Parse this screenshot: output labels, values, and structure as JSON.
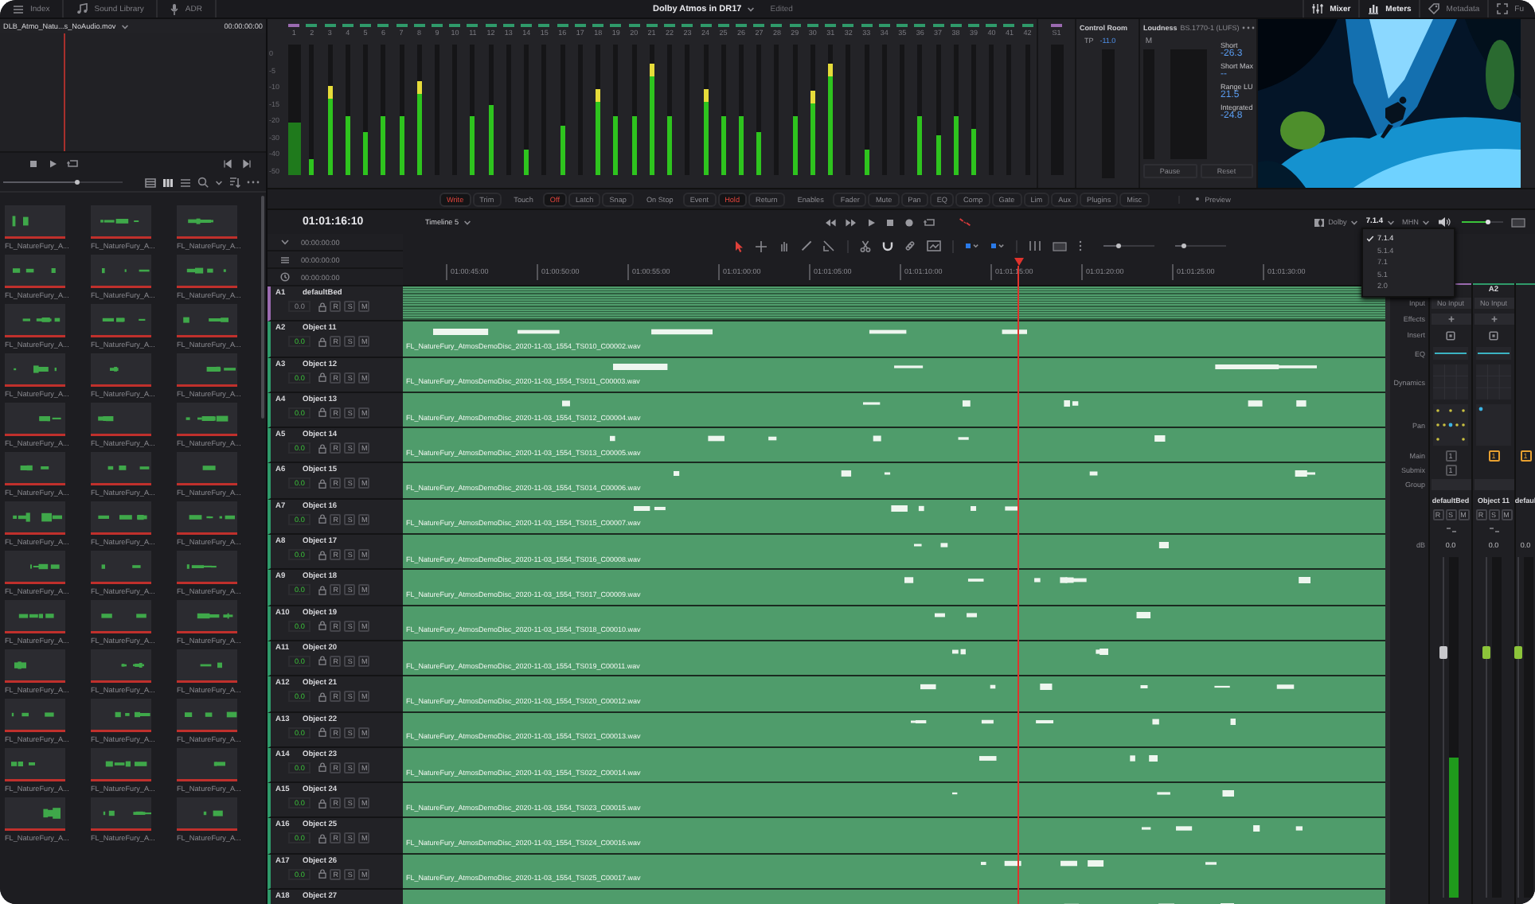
{
  "topbar": {
    "left_tabs": [
      {
        "label": "Index"
      },
      {
        "label": "Sound Library"
      },
      {
        "label": "ADR"
      }
    ],
    "project_title": "Dolby Atmos in DR17",
    "project_status": "Edited",
    "right_tabs": [
      {
        "label": "Mixer",
        "on": true
      },
      {
        "label": "Meters",
        "on": true
      },
      {
        "label": "Metadata",
        "on": false
      },
      {
        "label": "Fu",
        "on": false
      }
    ]
  },
  "viewer": {
    "clip_name": "DLB_Atmo_Natu...s_NoAudio.mov",
    "timecode": "00:00:00:00",
    "playhead": {
      "level": 0.24
    }
  },
  "media_pool": {
    "zoom": {
      "level": 0.6
    },
    "clips": [
      {
        "name": "FL_NatureFury_A..."
      },
      {
        "name": "FL_NatureFury_A..."
      },
      {
        "name": "FL_NatureFury_A..."
      },
      {
        "name": "FL_NatureFury_A..."
      },
      {
        "name": "FL_NatureFury_A..."
      },
      {
        "name": "FL_NatureFury_A..."
      },
      {
        "name": "FL_NatureFury_A..."
      },
      {
        "name": "FL_NatureFury_A..."
      },
      {
        "name": "FL_NatureFury_A..."
      },
      {
        "name": "FL_NatureFury_A..."
      },
      {
        "name": "FL_NatureFury_A..."
      },
      {
        "name": "FL_NatureFury_A..."
      },
      {
        "name": "FL_NatureFury_A..."
      },
      {
        "name": "FL_NatureFury_A..."
      },
      {
        "name": "FL_NatureFury_A..."
      },
      {
        "name": "FL_NatureFury_A..."
      },
      {
        "name": "FL_NatureFury_A..."
      },
      {
        "name": "FL_NatureFury_A..."
      },
      {
        "name": "FL_NatureFury_A..."
      },
      {
        "name": "FL_NatureFury_A..."
      },
      {
        "name": "FL_NatureFury_A..."
      },
      {
        "name": "FL_NatureFury_A..."
      },
      {
        "name": "FL_NatureFury_A..."
      },
      {
        "name": "FL_NatureFury_A..."
      },
      {
        "name": "FL_NatureFury_A..."
      },
      {
        "name": "FL_NatureFury_A..."
      },
      {
        "name": "FL_NatureFury_A..."
      },
      {
        "name": "FL_NatureFury_A..."
      },
      {
        "name": "FL_NatureFury_A..."
      },
      {
        "name": "FL_NatureFury_A..."
      },
      {
        "name": "FL_NatureFury_A..."
      },
      {
        "name": "FL_NatureFury_A..."
      },
      {
        "name": "FL_NatureFury_A..."
      },
      {
        "name": "FL_NatureFury_A..."
      },
      {
        "name": "FL_NatureFury_A..."
      },
      {
        "name": "FL_NatureFury_A..."
      },
      {
        "name": "FL_NatureFury_A..."
      },
      {
        "name": "FL_NatureFury_A..."
      },
      {
        "name": "FL_NatureFury_A..."
      }
    ]
  },
  "meter_bridge": {
    "scale": [
      "0",
      "-5",
      "-10",
      "-15",
      "-20",
      "-30",
      "-40",
      "-50"
    ],
    "channels": [
      {
        "label": "1",
        "kind": "bed",
        "level": 0.4,
        "over": false
      },
      {
        "label": "2",
        "kind": "object",
        "level": 0.12,
        "over": false
      },
      {
        "label": "3",
        "kind": "object",
        "level": 0.58,
        "over": true
      },
      {
        "label": "4",
        "kind": "object",
        "level": 0.45,
        "over": false
      },
      {
        "label": "5",
        "kind": "object",
        "level": 0.33,
        "over": false
      },
      {
        "label": "6",
        "kind": "object",
        "level": 0.45,
        "over": false
      },
      {
        "label": "7",
        "kind": "object",
        "level": 0.45,
        "over": false
      },
      {
        "label": "8",
        "kind": "object",
        "level": 0.62,
        "over": true
      },
      {
        "label": "9",
        "kind": "object",
        "level": 0,
        "over": false
      },
      {
        "label": "10",
        "kind": "object",
        "level": 0,
        "over": false
      },
      {
        "label": "11",
        "kind": "object",
        "level": 0.45,
        "over": false
      },
      {
        "label": "12",
        "kind": "object",
        "level": 0.53,
        "over": false
      },
      {
        "label": "13",
        "kind": "object",
        "level": 0,
        "over": false
      },
      {
        "label": "14",
        "kind": "object",
        "level": 0.2,
        "over": false
      },
      {
        "label": "15",
        "kind": "object",
        "level": 0,
        "over": false
      },
      {
        "label": "16",
        "kind": "object",
        "level": 0.37,
        "over": false
      },
      {
        "label": "17",
        "kind": "object",
        "level": 0,
        "over": false
      },
      {
        "label": "18",
        "kind": "object",
        "level": 0.56,
        "over": true
      },
      {
        "label": "19",
        "kind": "object",
        "level": 0.45,
        "over": false
      },
      {
        "label": "20",
        "kind": "object",
        "level": 0.45,
        "over": false
      },
      {
        "label": "21",
        "kind": "object",
        "level": 0.75,
        "over": true
      },
      {
        "label": "22",
        "kind": "object",
        "level": 0.45,
        "over": false
      },
      {
        "label": "23",
        "kind": "object",
        "level": 0,
        "over": false
      },
      {
        "label": "24",
        "kind": "object",
        "level": 0.56,
        "over": true
      },
      {
        "label": "25",
        "kind": "object",
        "level": 0.45,
        "over": false
      },
      {
        "label": "26",
        "kind": "object",
        "level": 0.45,
        "over": false
      },
      {
        "label": "27",
        "kind": "object",
        "level": 0.33,
        "over": false
      },
      {
        "label": "28",
        "kind": "object",
        "level": 0,
        "over": false
      },
      {
        "label": "29",
        "kind": "object",
        "level": 0.45,
        "over": false
      },
      {
        "label": "30",
        "kind": "object",
        "level": 0.55,
        "over": true
      },
      {
        "label": "31",
        "kind": "object",
        "level": 0.75,
        "over": true
      },
      {
        "label": "32",
        "kind": "object",
        "level": 0,
        "over": false
      },
      {
        "label": "33",
        "kind": "object",
        "level": 0.2,
        "over": false
      },
      {
        "label": "34",
        "kind": "object",
        "level": 0,
        "over": false
      },
      {
        "label": "35",
        "kind": "object",
        "level": 0,
        "over": false
      },
      {
        "label": "36",
        "kind": "object",
        "level": 0.45,
        "over": false
      },
      {
        "label": "37",
        "kind": "object",
        "level": 0.3,
        "over": false
      },
      {
        "label": "38",
        "kind": "object",
        "level": 0.45,
        "over": false
      },
      {
        "label": "39",
        "kind": "object",
        "level": 0.35,
        "over": false
      },
      {
        "label": "40",
        "kind": "object",
        "level": 0,
        "over": false
      },
      {
        "label": "41",
        "kind": "object",
        "level": 0,
        "over": false
      },
      {
        "label": "42",
        "kind": "object",
        "level": 0,
        "over": false
      }
    ],
    "monitor": {
      "label": "S1"
    }
  },
  "control_room": {
    "title": "Control Room",
    "tp_label": "TP",
    "tp_value": "-11.0"
  },
  "loudness": {
    "title": "Loudness",
    "standard": "BS.1770-1 (LUFS)",
    "meter_label": "M",
    "readings": [
      {
        "label": "Short",
        "value": "-26.3"
      },
      {
        "label": "Short Max",
        "value": "--"
      },
      {
        "label": "Range LU",
        "value": "21.5"
      },
      {
        "label": "Integrated",
        "value": "-24.8"
      }
    ],
    "buttons": [
      "Pause",
      "Reset"
    ]
  },
  "automation": {
    "groups": [
      {
        "buttons": [
          {
            "label": "Write",
            "selected": true
          },
          {
            "label": "Trim",
            "selected": false
          }
        ]
      },
      {
        "label": "Touch",
        "buttons": [
          {
            "label": "Off",
            "selected": true
          },
          {
            "label": "Latch",
            "selected": false
          },
          {
            "label": "Snap",
            "selected": false
          }
        ]
      },
      {
        "label": "On Stop",
        "buttons": [
          {
            "label": "Event",
            "selected": false
          },
          {
            "label": "Hold",
            "selected": true
          },
          {
            "label": "Return",
            "selected": false
          }
        ]
      },
      {
        "label": "Enables",
        "buttons": [
          {
            "label": "Fader",
            "selected": false
          },
          {
            "label": "Mute",
            "selected": false
          },
          {
            "label": "Pan",
            "selected": false
          },
          {
            "label": "EQ",
            "selected": false
          },
          {
            "label": "Comp",
            "selected": false
          },
          {
            "label": "Gate",
            "selected": false
          },
          {
            "label": "Lim",
            "selected": false
          },
          {
            "label": "Aux",
            "selected": false
          },
          {
            "label": "Plugins",
            "selected": false
          },
          {
            "label": "Misc",
            "selected": false
          }
        ]
      }
    ],
    "preview": {
      "label": "Preview",
      "on": false
    }
  },
  "editor": {
    "timecode": "01:01:16:10",
    "timeline_name": "Timeline 5",
    "renderer": "Dolby",
    "format": "7.1.4",
    "monitor": "MHN",
    "monitor_volume": {
      "level": 0.6
    },
    "timecodes": [
      "00:00:00:00",
      "00:00:00:00",
      "00:00:00:00"
    ],
    "ruler": [
      "01:00:45:00",
      "01:00:50:00",
      "01:00:55:00",
      "01:01:00:00",
      "01:01:05:00",
      "01:01:10:00",
      "01:01:15:00",
      "01:01:20:00",
      "01:01:25:00",
      "01:01:30:00"
    ],
    "zoom_sliders": [
      {
        "level": 0.25
      },
      {
        "level": 0.12
      }
    ],
    "tracks": [
      {
        "id": "A1",
        "name": "defaultBed",
        "kind": "bed",
        "volume": "0.0",
        "buttons": [
          "R",
          "S",
          "M"
        ]
      },
      {
        "id": "A2",
        "name": "Object 11",
        "kind": "object",
        "volume": "0.0",
        "buttons": [
          "R",
          "S",
          "M"
        ],
        "clip": "FL_NatureFury_AtmosDemoDisc_2020-11-03_1554_TS010_C00002.wav"
      },
      {
        "id": "A3",
        "name": "Object 12",
        "kind": "object",
        "volume": "0.0",
        "buttons": [
          "R",
          "S",
          "M"
        ],
        "clip": "FL_NatureFury_AtmosDemoDisc_2020-11-03_1554_TS011_C00003.wav"
      },
      {
        "id": "A4",
        "name": "Object 13",
        "kind": "object",
        "volume": "0.0",
        "buttons": [
          "R",
          "S",
          "M"
        ],
        "clip": "FL_NatureFury_AtmosDemoDisc_2020-11-03_1554_TS012_C00004.wav"
      },
      {
        "id": "A5",
        "name": "Object 14",
        "kind": "object",
        "volume": "0.0",
        "buttons": [
          "R",
          "S",
          "M"
        ],
        "clip": "FL_NatureFury_AtmosDemoDisc_2020-11-03_1554_TS013_C00005.wav"
      },
      {
        "id": "A6",
        "name": "Object 15",
        "kind": "object",
        "volume": "0.0",
        "buttons": [
          "R",
          "S",
          "M"
        ],
        "clip": "FL_NatureFury_AtmosDemoDisc_2020-11-03_1554_TS014_C00006.wav"
      },
      {
        "id": "A7",
        "name": "Object 16",
        "kind": "object",
        "volume": "0.0",
        "buttons": [
          "R",
          "S",
          "M"
        ],
        "clip": "FL_NatureFury_AtmosDemoDisc_2020-11-03_1554_TS015_C00007.wav"
      },
      {
        "id": "A8",
        "name": "Object 17",
        "kind": "object",
        "volume": "0.0",
        "buttons": [
          "R",
          "S",
          "M"
        ],
        "clip": "FL_NatureFury_AtmosDemoDisc_2020-11-03_1554_TS016_C00008.wav"
      },
      {
        "id": "A9",
        "name": "Object 18",
        "kind": "object",
        "volume": "0.0",
        "buttons": [
          "R",
          "S",
          "M"
        ],
        "clip": "FL_NatureFury_AtmosDemoDisc_2020-11-03_1554_TS017_C00009.wav"
      },
      {
        "id": "A10",
        "name": "Object 19",
        "kind": "object",
        "volume": "0.0",
        "buttons": [
          "R",
          "S",
          "M"
        ],
        "clip": "FL_NatureFury_AtmosDemoDisc_2020-11-03_1554_TS018_C00010.wav"
      },
      {
        "id": "A11",
        "name": "Object 20",
        "kind": "object",
        "volume": "0.0",
        "buttons": [
          "R",
          "S",
          "M"
        ],
        "clip": "FL_NatureFury_AtmosDemoDisc_2020-11-03_1554_TS019_C00011.wav"
      },
      {
        "id": "A12",
        "name": "Object 21",
        "kind": "object",
        "volume": "0.0",
        "buttons": [
          "R",
          "S",
          "M"
        ],
        "clip": "FL_NatureFury_AtmosDemoDisc_2020-11-03_1554_TS020_C00012.wav"
      },
      {
        "id": "A13",
        "name": "Object 22",
        "kind": "object",
        "volume": "0.0",
        "buttons": [
          "R",
          "S",
          "M"
        ],
        "clip": "FL_NatureFury_AtmosDemoDisc_2020-11-03_1554_TS021_C00013.wav"
      },
      {
        "id": "A14",
        "name": "Object 23",
        "kind": "object",
        "volume": "0.0",
        "buttons": [
          "R",
          "S",
          "M"
        ],
        "clip": "FL_NatureFury_AtmosDemoDisc_2020-11-03_1554_TS022_C00014.wav"
      },
      {
        "id": "A15",
        "name": "Object 24",
        "kind": "object",
        "volume": "0.0",
        "buttons": [
          "R",
          "S",
          "M"
        ],
        "clip": "FL_NatureFury_AtmosDemoDisc_2020-11-03_1554_TS023_C00015.wav"
      },
      {
        "id": "A16",
        "name": "Object 25",
        "kind": "object",
        "volume": "0.0",
        "buttons": [
          "R",
          "S",
          "M"
        ],
        "clip": "FL_NatureFury_AtmosDemoDisc_2020-11-03_1554_TS024_C00016.wav"
      },
      {
        "id": "A17",
        "name": "Object 26",
        "kind": "object",
        "volume": "0.0",
        "buttons": [
          "R",
          "S",
          "M"
        ],
        "clip": "FL_NatureFury_AtmosDemoDisc_2020-11-03_1554_TS025_C00017.wav"
      },
      {
        "id": "A18",
        "name": "Object 27",
        "kind": "object"
      }
    ]
  },
  "format_menu": {
    "items": [
      {
        "label": "7.1.4",
        "selected": true
      },
      {
        "label": "5.1.4",
        "selected": false
      },
      {
        "label": "7.1",
        "selected": false
      },
      {
        "label": "5.1",
        "selected": false
      },
      {
        "label": "2.0",
        "selected": false
      }
    ]
  },
  "mixer": {
    "row_labels": [
      "Input",
      "Effects",
      "Insert",
      "EQ",
      "Dynamics",
      "Pan",
      "Main",
      "Submix",
      "Group"
    ],
    "gain_label": "dB",
    "strips": [
      {
        "kind": "bed",
        "input": "No Input",
        "main": "1",
        "submix": "1",
        "name": "defaultBed",
        "buttons": [
          "R",
          "S",
          "M"
        ],
        "gain": "0.0",
        "fader": {
          "level": 0.72
        },
        "meter": {
          "level": 0.41
        }
      },
      {
        "kind": "object",
        "header": "A2",
        "input": "No Input",
        "main": "1",
        "name": "Object 11",
        "buttons": [
          "R",
          "S",
          "M"
        ],
        "gain": "0.0",
        "fader": {
          "level": 0.72
        },
        "meter": {
          "level": 0
        }
      },
      {
        "kind": "object",
        "main": "1",
        "name": "defaul",
        "gain": "0.0",
        "fader": {
          "level": 0.72
        },
        "meter": {
          "level": 0
        }
      }
    ]
  }
}
